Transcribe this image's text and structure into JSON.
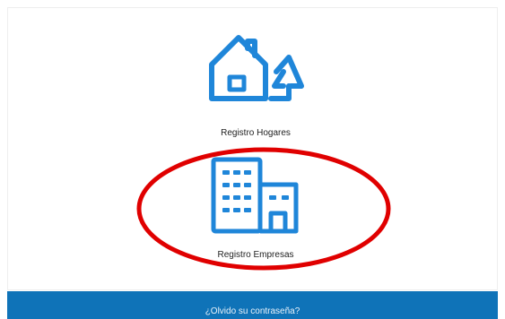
{
  "options": [
    {
      "label": "Registro Hogares",
      "icon": "house-tree-icon"
    },
    {
      "label": "Registro Empresas",
      "icon": "office-buildings-icon"
    }
  ],
  "footer": {
    "forgot_password_label": "¿Olvido su contraseña?"
  },
  "colors": {
    "icon_blue": "#1f86d9",
    "footer_blue": "#0f73b8",
    "annotation_red": "#e00000"
  }
}
